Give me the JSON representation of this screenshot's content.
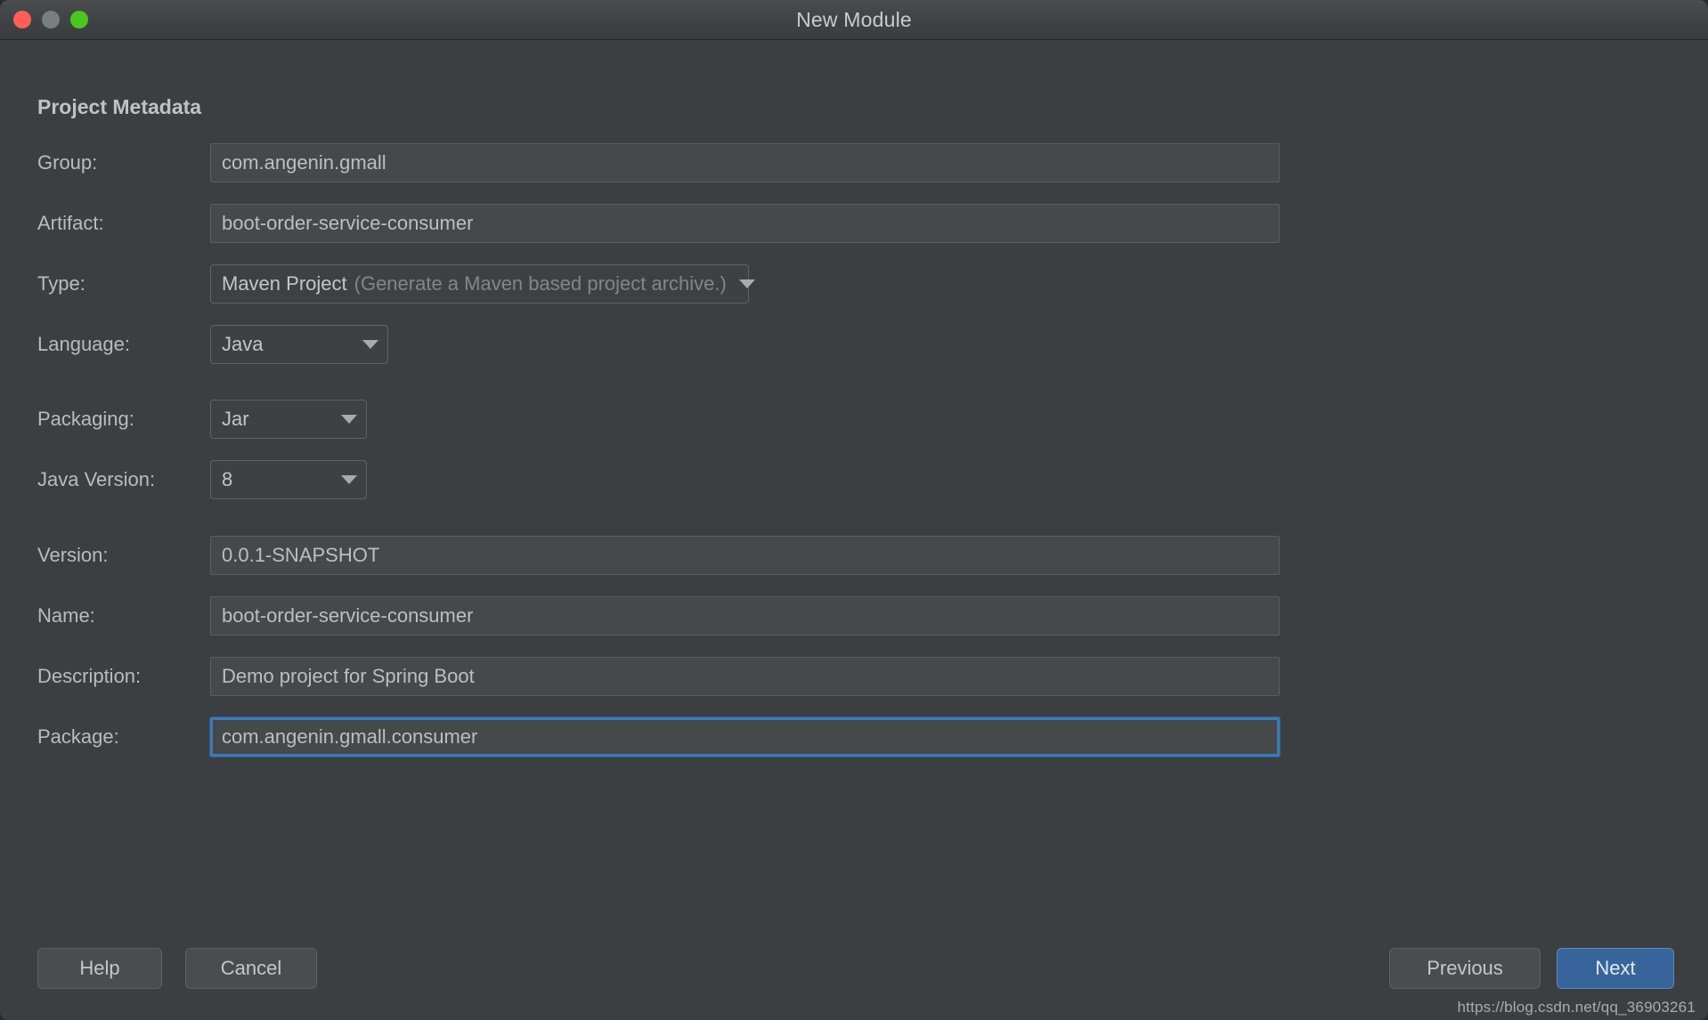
{
  "window": {
    "title": "New Module",
    "traffic_lights": [
      {
        "name": "close",
        "color": "#ff5f57"
      },
      {
        "name": "minimize",
        "color": "#7b7e80"
      },
      {
        "name": "zoom",
        "color": "#4cc61f"
      }
    ]
  },
  "section": {
    "title": "Project Metadata"
  },
  "fields": {
    "group": {
      "label": "Group:",
      "value": "com.angenin.gmall"
    },
    "artifact": {
      "label": "Artifact:",
      "value": "boot-order-service-consumer"
    },
    "type": {
      "label": "Type:",
      "value": "Maven Project",
      "hint": "(Generate a Maven based project archive.)"
    },
    "language": {
      "label": "Language:",
      "value": "Java"
    },
    "packaging": {
      "label": "Packaging:",
      "value": "Jar"
    },
    "java_version": {
      "label": "Java Version:",
      "value": "8"
    },
    "version": {
      "label": "Version:",
      "value": "0.0.1-SNAPSHOT"
    },
    "name": {
      "label": "Name:",
      "value": "boot-order-service-consumer"
    },
    "description": {
      "label": "Description:",
      "value": "Demo project for Spring Boot"
    },
    "package": {
      "label": "Package:",
      "value": "com.angenin.gmall.consumer",
      "focused": true
    }
  },
  "footer": {
    "help": "Help",
    "cancel": "Cancel",
    "previous": "Previous",
    "next": "Next"
  },
  "watermark": "https://blog.csdn.net/qq_36903261",
  "colors": {
    "window_bg": "#3c3f41",
    "field_bg": "#45494a",
    "accent_blue": "#3d79b8",
    "primary_button": "#37659b",
    "text": "#bcbfc0",
    "muted_text": "#80868a"
  }
}
